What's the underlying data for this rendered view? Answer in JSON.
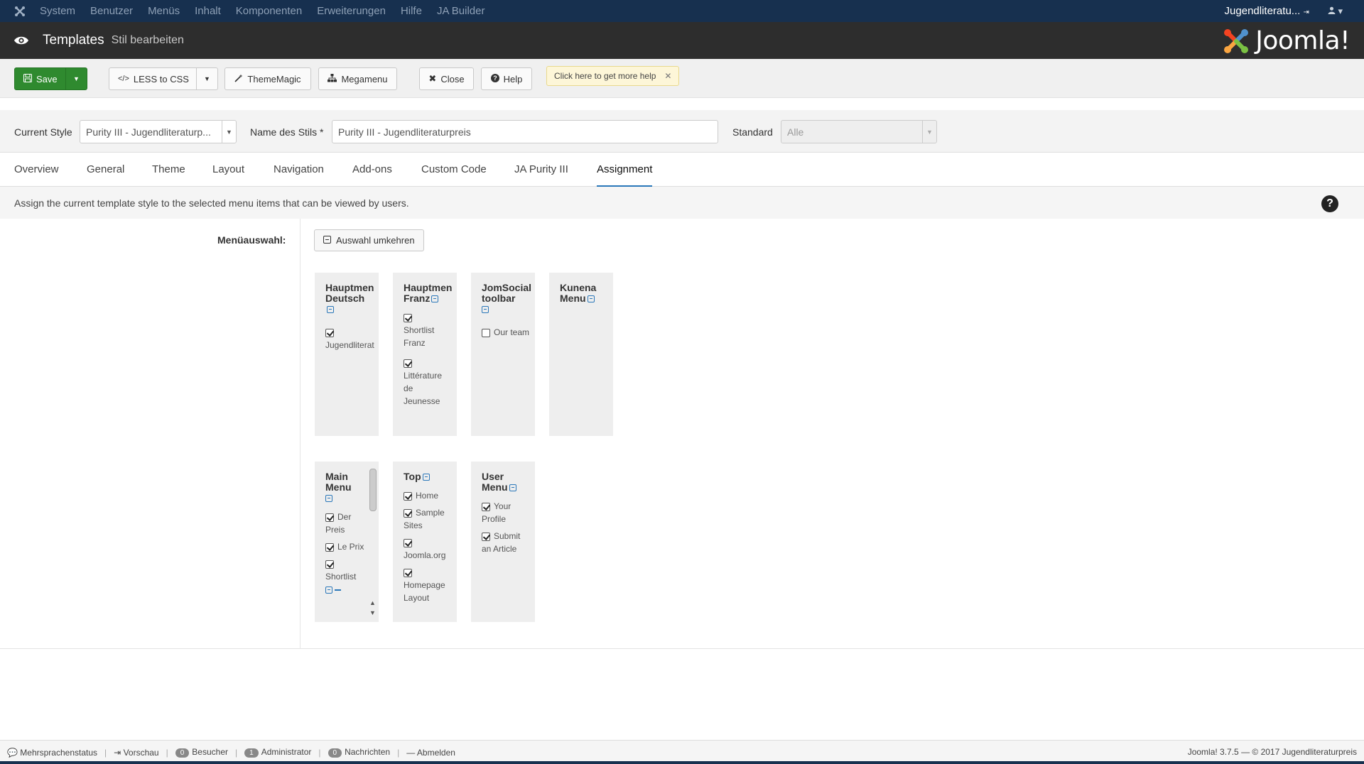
{
  "topnav": {
    "items": [
      "System",
      "Benutzer",
      "Menüs",
      "Inhalt",
      "Komponenten",
      "Erweiterungen",
      "Hilfe",
      "JA Builder"
    ],
    "site": "Jugendliteratu..."
  },
  "titlebar": {
    "title": "Templates",
    "subtitle": "Stil bearbeiten",
    "brand": "Joomla!"
  },
  "toolbar": {
    "save": "Save",
    "less": "LESS to CSS",
    "thememagic": "ThemeMagic",
    "megamenu": "Megamenu",
    "close": "Close",
    "help": "Help",
    "tip": "Click here to get more help"
  },
  "stylebar": {
    "current_label": "Current Style",
    "current_value": "Purity III - Jugendliteraturp...",
    "name_label": "Name des Stils *",
    "name_value": "Purity III - Jugendliteraturpreis",
    "standard_label": "Standard",
    "standard_value": "Alle"
  },
  "tabs": [
    "Overview",
    "General",
    "Theme",
    "Layout",
    "Navigation",
    "Add-ons",
    "Custom Code",
    "JA Purity III",
    "Assignment"
  ],
  "info": "Assign the current template style to the selected menu items that can be viewed by users.",
  "assignment": {
    "label": "Menüauswahl:",
    "invert": "Auswahl umkehren",
    "menus": [
      {
        "title": "Hauptmen Deutsch",
        "items": [
          {
            "label": "Jugendliterat",
            "checked": true
          }
        ]
      },
      {
        "title": "Hauptmen Franz",
        "items": [
          {
            "label": "Shortlist Franz",
            "checked": true
          },
          {
            "label": "Littérature de Jeunesse",
            "checked": true
          }
        ]
      },
      {
        "title": "JomSocial toolbar",
        "items": [
          {
            "label": "Our team",
            "checked": false
          }
        ]
      },
      {
        "title": "Kunena Menu",
        "items": []
      },
      {
        "title": "Main Menu",
        "items": [
          {
            "label": "Der Preis",
            "checked": true
          },
          {
            "label": "Le Prix",
            "checked": true
          },
          {
            "label": "Shortlist",
            "checked": true
          }
        ]
      },
      {
        "title": "Top",
        "items": [
          {
            "label": "Home",
            "checked": true
          },
          {
            "label": "Sample Sites",
            "checked": true
          },
          {
            "label": "Joomla.org",
            "checked": true
          },
          {
            "label": "Homepage Layout",
            "checked": true
          }
        ]
      },
      {
        "title": "User Menu",
        "items": [
          {
            "label": "Your Profile",
            "checked": true
          },
          {
            "label": "Submit an Article",
            "checked": true
          }
        ]
      }
    ]
  },
  "status": {
    "multilang": "Mehrsprachenstatus",
    "preview": "Vorschau",
    "visitors_count": "0",
    "visitors": "Besucher",
    "admin_count": "1",
    "admin": "Administrator",
    "messages_count": "0",
    "messages": "Nachrichten",
    "logout": "Abmelden",
    "version": "Joomla! 3.7.5  —  © 2017 Jugendliteraturpreis"
  },
  "colors": {
    "nav_bg": "#17304f",
    "title_bg": "#2d2d2d",
    "save_green": "#2f8a2f",
    "accent_blue": "#2a77b9"
  }
}
